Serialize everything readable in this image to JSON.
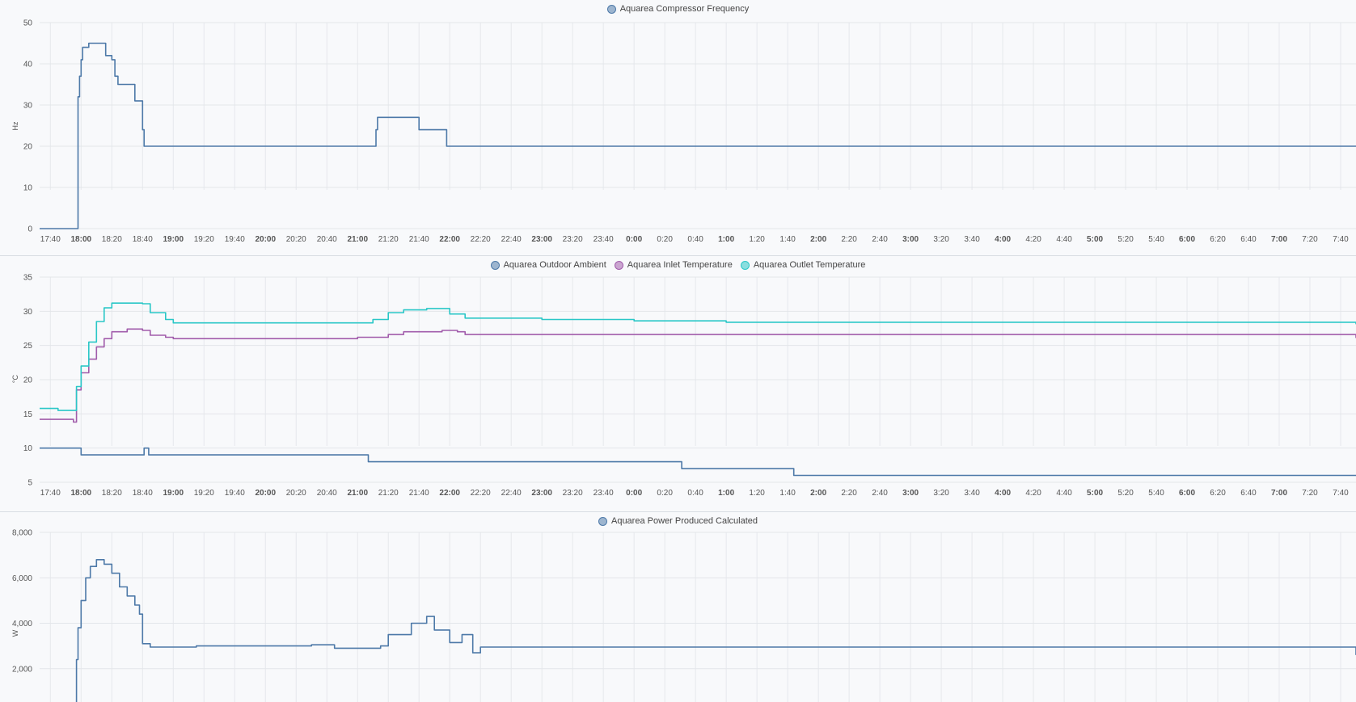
{
  "x_ticks": [
    "17:40",
    "18:00",
    "18:20",
    "18:40",
    "19:00",
    "19:20",
    "19:40",
    "20:00",
    "20:20",
    "20:40",
    "21:00",
    "21:20",
    "21:40",
    "22:00",
    "22:20",
    "22:40",
    "23:00",
    "23:20",
    "23:40",
    "0:00",
    "0:20",
    "0:40",
    "1:00",
    "1:20",
    "1:40",
    "2:00",
    "2:20",
    "2:40",
    "3:00",
    "3:20",
    "3:40",
    "4:00",
    "4:20",
    "4:40",
    "5:00",
    "5:20",
    "5:40",
    "6:00",
    "6:20",
    "6:40",
    "7:00",
    "7:20",
    "7:40"
  ],
  "bold_ticks": [
    "18:00",
    "19:00",
    "20:00",
    "21:00",
    "22:00",
    "23:00",
    "0:00",
    "1:00",
    "2:00",
    "3:00",
    "4:00",
    "5:00",
    "6:00",
    "7:00"
  ],
  "chart_data": [
    {
      "type": "line",
      "ylabel": "Hz",
      "ylim": [
        0,
        50
      ],
      "yticks": [
        "0",
        "10",
        "20",
        "30",
        "40",
        "50"
      ],
      "grid": true,
      "legend_position": "top-center",
      "series": [
        {
          "name": "Aquarea Compressor Frequency",
          "color": "#4d79a8",
          "points": [
            [
              "17:33",
              0
            ],
            [
              "17:57",
              0
            ],
            [
              "17:58",
              32
            ],
            [
              "17:59",
              37
            ],
            [
              "18:00",
              41
            ],
            [
              "18:01",
              44
            ],
            [
              "18:05",
              45
            ],
            [
              "18:15",
              45
            ],
            [
              "18:16",
              42
            ],
            [
              "18:20",
              41
            ],
            [
              "18:22",
              37
            ],
            [
              "18:24",
              35
            ],
            [
              "18:34",
              35
            ],
            [
              "18:35",
              31
            ],
            [
              "18:39",
              31
            ],
            [
              "18:40",
              24
            ],
            [
              "18:41",
              20
            ],
            [
              "21:10",
              20
            ],
            [
              "21:12",
              24
            ],
            [
              "21:13",
              27
            ],
            [
              "21:38",
              27
            ],
            [
              "21:40",
              24
            ],
            [
              "21:56",
              24
            ],
            [
              "21:58",
              20
            ],
            [
              "7:50",
              20
            ]
          ]
        }
      ]
    },
    {
      "type": "line",
      "ylabel": "°C",
      "ylim": [
        5,
        35
      ],
      "yticks": [
        "5",
        "10",
        "15",
        "20",
        "25",
        "30",
        "35"
      ],
      "grid": true,
      "legend_position": "top-center",
      "series": [
        {
          "name": "Aquarea Outdoor Ambient",
          "color": "#4d79a8",
          "points": [
            [
              "17:33",
              10
            ],
            [
              "17:59",
              10
            ],
            [
              "18:00",
              9
            ],
            [
              "18:40",
              9
            ],
            [
              "18:41",
              10
            ],
            [
              "18:44",
              9
            ],
            [
              "21:05",
              9
            ],
            [
              "21:07",
              8
            ],
            [
              "0:30",
              8
            ],
            [
              "0:31",
              7
            ],
            [
              "1:43",
              7
            ],
            [
              "1:44",
              6
            ],
            [
              "7:50",
              6
            ]
          ]
        },
        {
          "name": "Aquarea Inlet Temperature",
          "color": "#a15cab",
          "points": [
            [
              "17:33",
              14.2
            ],
            [
              "17:54",
              14.2
            ],
            [
              "17:55",
              13.8
            ],
            [
              "17:57",
              18.5
            ],
            [
              "18:00",
              21
            ],
            [
              "18:05",
              23
            ],
            [
              "18:10",
              24.8
            ],
            [
              "18:15",
              26
            ],
            [
              "18:20",
              27
            ],
            [
              "18:30",
              27.4
            ],
            [
              "18:40",
              27.2
            ],
            [
              "18:45",
              26.5
            ],
            [
              "18:55",
              26.2
            ],
            [
              "19:00",
              26
            ],
            [
              "20:40",
              26
            ],
            [
              "21:00",
              26.2
            ],
            [
              "21:20",
              26.6
            ],
            [
              "21:30",
              27
            ],
            [
              "21:55",
              27.2
            ],
            [
              "22:05",
              27
            ],
            [
              "22:10",
              26.6
            ],
            [
              "7:50",
              26.1
            ]
          ]
        },
        {
          "name": "Aquarea Outlet Temperature",
          "color": "#2ac7c7",
          "points": [
            [
              "17:33",
              15.8
            ],
            [
              "17:44",
              15.8
            ],
            [
              "17:45",
              15.5
            ],
            [
              "17:56",
              15.5
            ],
            [
              "17:57",
              19
            ],
            [
              "18:00",
              22
            ],
            [
              "18:05",
              25.5
            ],
            [
              "18:10",
              28.5
            ],
            [
              "18:15",
              30.5
            ],
            [
              "18:20",
              31.2
            ],
            [
              "18:40",
              31.1
            ],
            [
              "18:45",
              29.8
            ],
            [
              "18:55",
              28.8
            ],
            [
              "19:00",
              28.3
            ],
            [
              "21:00",
              28.3
            ],
            [
              "21:10",
              28.8
            ],
            [
              "21:20",
              29.8
            ],
            [
              "21:30",
              30.2
            ],
            [
              "21:45",
              30.4
            ],
            [
              "22:00",
              29.6
            ],
            [
              "22:10",
              29
            ],
            [
              "23:00",
              28.8
            ],
            [
              "0:00",
              28.6
            ],
            [
              "1:00",
              28.4
            ],
            [
              "7:50",
              28.1
            ]
          ]
        }
      ]
    },
    {
      "type": "line",
      "ylabel": "W",
      "ylim": [
        0,
        8000
      ],
      "yticks": [
        "2,000",
        "4,000",
        "6,000",
        "8,000"
      ],
      "grid": true,
      "legend_position": "top-center",
      "series": [
        {
          "name": "Aquarea Power Produced Calculated",
          "color": "#4d79a8",
          "points": [
            [
              "17:56",
              0
            ],
            [
              "17:57",
              2400
            ],
            [
              "17:58",
              3800
            ],
            [
              "18:00",
              5000
            ],
            [
              "18:03",
              6000
            ],
            [
              "18:06",
              6500
            ],
            [
              "18:10",
              6800
            ],
            [
              "18:15",
              6600
            ],
            [
              "18:20",
              6200
            ],
            [
              "18:25",
              5600
            ],
            [
              "18:30",
              5200
            ],
            [
              "18:35",
              4800
            ],
            [
              "18:38",
              4400
            ],
            [
              "18:40",
              3100
            ],
            [
              "18:45",
              2950
            ],
            [
              "19:15",
              3000
            ],
            [
              "20:30",
              3050
            ],
            [
              "20:45",
              2900
            ],
            [
              "21:15",
              3000
            ],
            [
              "21:20",
              3500
            ],
            [
              "21:35",
              4000
            ],
            [
              "21:45",
              4300
            ],
            [
              "21:50",
              3700
            ],
            [
              "22:00",
              3150
            ],
            [
              "22:08",
              3500
            ],
            [
              "22:15",
              2700
            ],
            [
              "22:20",
              2950
            ],
            [
              "7:50",
              2600
            ]
          ]
        }
      ]
    }
  ]
}
